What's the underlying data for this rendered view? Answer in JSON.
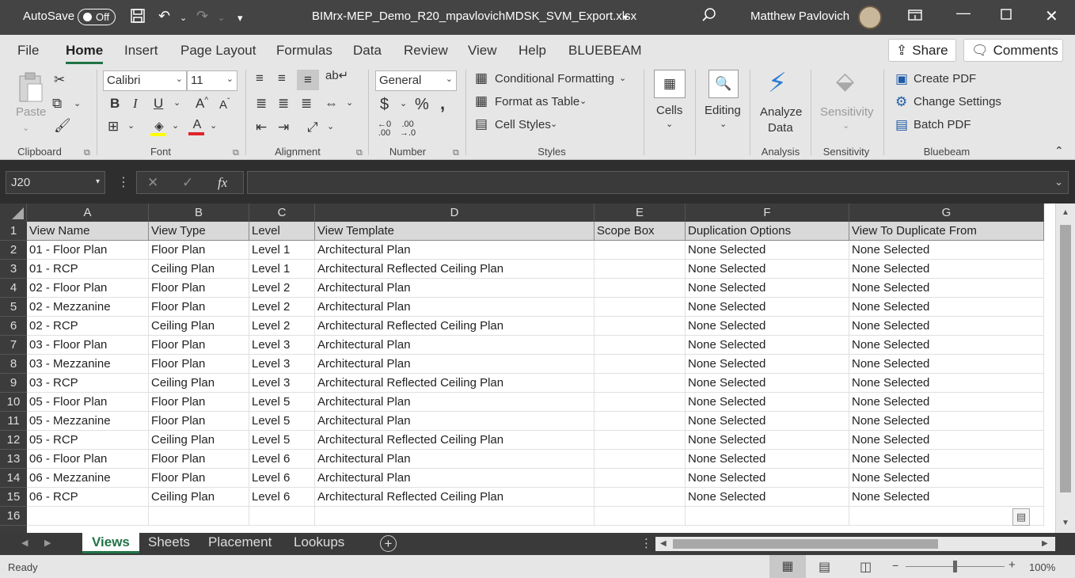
{
  "titlebar": {
    "autosave_label": "AutoSave",
    "autosave_state": "Off",
    "doc_title": "BIMrx-MEP_Demo_R20_mpavlovichMDSK_SVM_Export.xlsx",
    "user_name": "Matthew Pavlovich"
  },
  "ribbon_tabs": [
    "File",
    "Home",
    "Insert",
    "Page Layout",
    "Formulas",
    "Data",
    "Review",
    "View",
    "Help",
    "BLUEBEAM"
  ],
  "top_buttons": {
    "share": "Share",
    "comments": "Comments"
  },
  "ribbon": {
    "clipboard": {
      "paste": "Paste",
      "label": "Clipboard"
    },
    "font": {
      "name": "Calibri",
      "size": "11",
      "label": "Font"
    },
    "alignment": {
      "label": "Alignment"
    },
    "number": {
      "format": "General",
      "label": "Number"
    },
    "styles": {
      "conditional": "Conditional Formatting",
      "table": "Format as Table",
      "cell_styles": "Cell Styles",
      "label": "Styles"
    },
    "cells": {
      "label": "Cells"
    },
    "editing": {
      "label": "Editing"
    },
    "analysis": {
      "analyze_line1": "Analyze",
      "analyze_line2": "Data",
      "label": "Analysis"
    },
    "sensitivity": {
      "button": "Sensitivity",
      "label": "Sensitivity"
    },
    "bluebeam": {
      "create_pdf": "Create PDF",
      "change_settings": "Change Settings",
      "batch_pdf": "Batch PDF",
      "label": "Bluebeam"
    }
  },
  "formula_bar": {
    "name_box": "J20",
    "fx": "fx",
    "formula": ""
  },
  "sheet": {
    "columns": [
      "A",
      "B",
      "C",
      "D",
      "E",
      "F",
      "G"
    ],
    "header": [
      "View Name",
      "View Type",
      "Level",
      "View Template",
      "Scope Box",
      "Duplication Options",
      "View To Duplicate From"
    ],
    "rows": [
      [
        "01 - Floor Plan",
        "Floor Plan",
        "Level 1",
        "Architectural Plan",
        "",
        "None Selected",
        "None Selected"
      ],
      [
        "01 - RCP",
        "Ceiling Plan",
        "Level 1",
        "Architectural Reflected Ceiling Plan",
        "",
        "None Selected",
        "None Selected"
      ],
      [
        "02 - Floor Plan",
        "Floor Plan",
        "Level 2",
        "Architectural Plan",
        "",
        "None Selected",
        "None Selected"
      ],
      [
        "02 - Mezzanine",
        "Floor Plan",
        "Level 2",
        "Architectural Plan",
        "",
        "None Selected",
        "None Selected"
      ],
      [
        "02 - RCP",
        "Ceiling Plan",
        "Level 2",
        "Architectural Reflected Ceiling Plan",
        "",
        "None Selected",
        "None Selected"
      ],
      [
        "03 - Floor Plan",
        "Floor Plan",
        "Level 3",
        "Architectural Plan",
        "",
        "None Selected",
        "None Selected"
      ],
      [
        "03 - Mezzanine",
        "Floor Plan",
        "Level 3",
        "Architectural Plan",
        "",
        "None Selected",
        "None Selected"
      ],
      [
        "03 - RCP",
        "Ceiling Plan",
        "Level 3",
        "Architectural Reflected Ceiling Plan",
        "",
        "None Selected",
        "None Selected"
      ],
      [
        "05 - Floor Plan",
        "Floor Plan",
        "Level 5",
        "Architectural Plan",
        "",
        "None Selected",
        "None Selected"
      ],
      [
        "05 - Mezzanine",
        "Floor Plan",
        "Level 5",
        "Architectural Plan",
        "",
        "None Selected",
        "None Selected"
      ],
      [
        "05 - RCP",
        "Ceiling Plan",
        "Level 5",
        "Architectural Reflected Ceiling Plan",
        "",
        "None Selected",
        "None Selected"
      ],
      [
        "06 - Floor Plan",
        "Floor Plan",
        "Level 6",
        "Architectural Plan",
        "",
        "None Selected",
        "None Selected"
      ],
      [
        "06 - Mezzanine",
        "Floor Plan",
        "Level 6",
        "Architectural Plan",
        "",
        "None Selected",
        "None Selected"
      ],
      [
        "06 - RCP",
        "Ceiling Plan",
        "Level 6",
        "Architectural Reflected Ceiling Plan",
        "",
        "None Selected",
        "None Selected"
      ],
      [
        "",
        "",
        "",
        "",
        "",
        "",
        ""
      ]
    ]
  },
  "sheet_tabs": [
    "Views",
    "Sheets",
    "Placement",
    "Lookups"
  ],
  "status": {
    "ready": "Ready",
    "zoom": "100%"
  },
  "colors": {
    "accent": "#217346",
    "titlebar": "#444444",
    "ribbon": "#e6e6e6"
  }
}
